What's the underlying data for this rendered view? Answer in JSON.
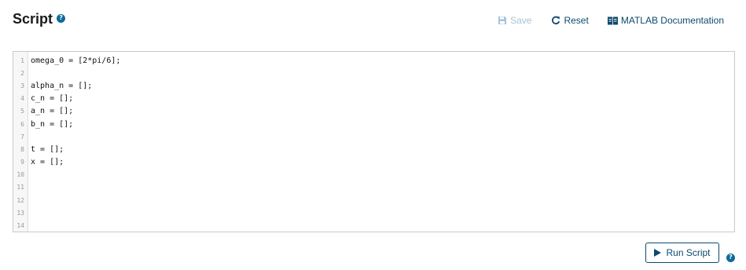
{
  "header": {
    "title": "Script",
    "help_glyph": "?"
  },
  "toolbar": {
    "save_label": "Save",
    "reset_label": "Reset",
    "doc_label": "MATLAB Documentation"
  },
  "editor": {
    "lines": [
      {
        "num": "1",
        "code": "omega_0 = [2*pi/6];"
      },
      {
        "num": "2",
        "code": ""
      },
      {
        "num": "3",
        "code": "alpha_n = [];"
      },
      {
        "num": "4",
        "code": "c_n = [];"
      },
      {
        "num": "5",
        "code": "a_n = [];"
      },
      {
        "num": "6",
        "code": "b_n = [];"
      },
      {
        "num": "7",
        "code": ""
      },
      {
        "num": "8",
        "code": "t = [];"
      },
      {
        "num": "9",
        "code": "x = [];"
      },
      {
        "num": "10",
        "code": ""
      },
      {
        "num": "11",
        "code": ""
      },
      {
        "num": "12",
        "code": ""
      },
      {
        "num": "13",
        "code": ""
      },
      {
        "num": "14",
        "code": ""
      }
    ]
  },
  "footer": {
    "run_label": "Run Script",
    "help_glyph": "?"
  },
  "icons": {
    "save": "save-icon",
    "reset": "reset-icon",
    "doc": "book-icon",
    "run": "play-icon",
    "help": "help-icon"
  },
  "colors": {
    "accent": "#0c4a6e",
    "help": "#0c6b9a",
    "disabled": "#a8c3d6"
  }
}
